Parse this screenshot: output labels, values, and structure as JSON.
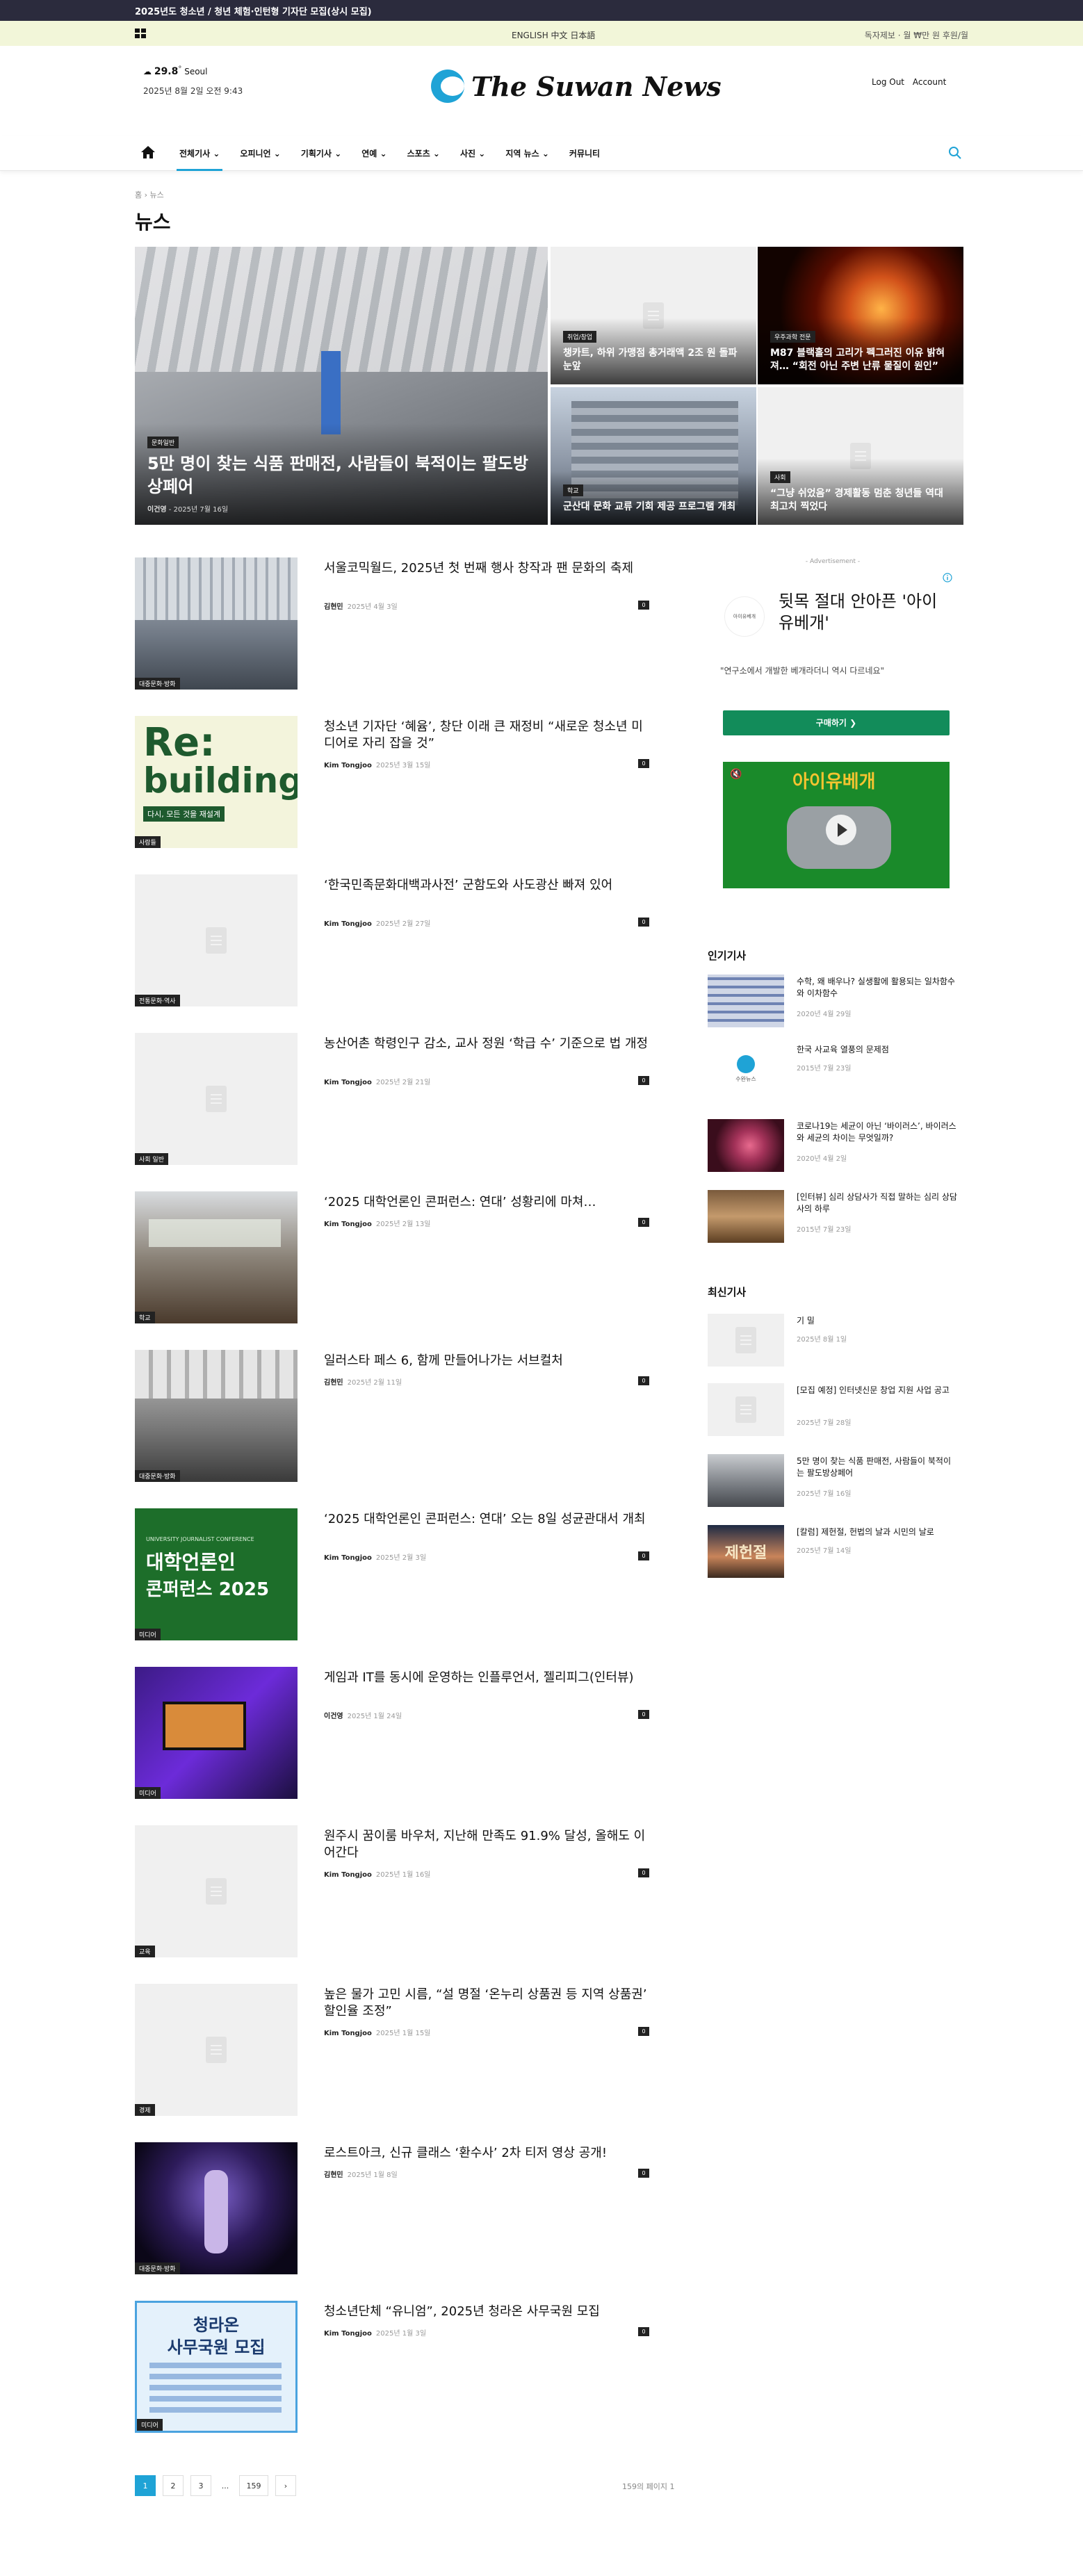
{
  "topbar": {
    "headline": "2025년도 청소년 / 청년 체험·인턴형 기자단 모집(상시 모집)"
  },
  "subbar": {
    "languages": "ENGLISH  中文  日本語",
    "right": "독자제보 · 월 ₩만 원 후원/월"
  },
  "header": {
    "weather_temp": "29.8",
    "weather_unit": "°",
    "weather_city": "Seoul",
    "datetime": "2025년 8월 2일 오전 9:43",
    "logo_text": "The Suwan News",
    "logout": "Log Out",
    "account": "Account"
  },
  "nav": {
    "items": [
      "전체기사",
      "오피니언",
      "기획기사",
      "연예",
      "스포츠",
      "사진",
      "지역 뉴스",
      "커뮤니티"
    ],
    "dropdown_marker": "⌄"
  },
  "breadcrumb": "홈 › 뉴스",
  "page_title": "뉴스",
  "hero": [
    {
      "badge": "문화일반",
      "title": "5만 명이 찾는 식품 판매전, 사람들이 북적이는 팔도방상페어",
      "author": "이건영",
      "date": "2025년 7월 16일"
    },
    {
      "badge": "취업/창업",
      "title": "챙카트, 하위 가맹점 총거래액 2조 원 돌파 눈앞"
    },
    {
      "badge": "우주과학 전문",
      "title": "M87 블랙홀의 고리가 펙그러진 이유 밝혀져… “회전 아닌 주변 난류 물질이 원인”"
    },
    {
      "badge": "학교",
      "title": "군산대 문화 교류 기회 제공 프로그램 개최"
    },
    {
      "badge": "사회",
      "title": "“그냥 쉬었음” 경제활동 멈춘 청년들 역대 최고치 찍었다"
    }
  ],
  "articles": [
    {
      "category": "대중문화·방화",
      "title": "서울코믹월드, 2025년 첫 번째 행사 창작과 팬 문화의 축제",
      "author": "김현민",
      "date": "2025년 4월 3일",
      "comments": "0"
    },
    {
      "category": "사람들",
      "title": "청소년 기자단 ‘혜윰’, 창단 이래 큰 재정비 “새로운 청소년 미디어로 자리 잡을 것”",
      "author": "Kim Tongjoo",
      "date": "2025년 3월 15일",
      "comments": "0"
    },
    {
      "category": "전통문화·역사",
      "title": "‘한국민족문화대백과사전’ 군함도와 사도광산 빠져 있어",
      "author": "Kim Tongjoo",
      "date": "2025년 2월 27일",
      "comments": "0"
    },
    {
      "category": "사회 일반",
      "title": "농산어촌 학령인구 감소, 교사 정원 ‘학급 수’ 기준으로 법 개정",
      "author": "Kim Tongjoo",
      "date": "2025년 2월 21일",
      "comments": "0"
    },
    {
      "category": "학교",
      "title": "‘2025 대학언론인 콘퍼런스: 연대’ 성황리에 마쳐…",
      "author": "Kim Tongjoo",
      "date": "2025년 2월 13일",
      "comments": "0"
    },
    {
      "category": "대중문화·방화",
      "title": "일러스타 페스 6, 함께 만들어나가는 서브컬처",
      "author": "김현민",
      "date": "2025년 2월 11일",
      "comments": "0"
    },
    {
      "category": "미디어",
      "title": "‘2025 대학언론인 콘퍼런스: 연대’ 오는 8일 성균관대서 개최",
      "author": "Kim Tongjoo",
      "date": "2025년 2월 3일",
      "comments": "0"
    },
    {
      "category": "미디어",
      "title": "게임과 IT를 동시에 운영하는 인플루언서, 젤리피그(인터뷰)",
      "author": "이건영",
      "date": "2025년 1월 24일",
      "comments": "0"
    },
    {
      "category": "교육",
      "title": "원주시 꿈이룸 바우처, 지난해 만족도 91.9% 달성, 올해도 이어간다",
      "author": "Kim Tongjoo",
      "date": "2025년 1월 16일",
      "comments": "0"
    },
    {
      "category": "경제",
      "title": "높은 물가 고민 시름, “설 명절 ‘온누리 상품권 등 지역 상품권’ 할인율 조정”",
      "author": "Kim Tongjoo",
      "date": "2025년 1월 15일",
      "comments": "0"
    },
    {
      "category": "대중문화·방화",
      "title": "로스트아크, 신규 클래스 ‘환수사’ 2차 티저 영상 공개!",
      "author": "김현민",
      "date": "2025년 1월 8일",
      "comments": "0"
    },
    {
      "category": "미디어",
      "title": "청소년단체 “유니엄”, 2025년 청라온 사무국원 모집",
      "author": "Kim Tongjoo",
      "date": "2025년 1월 3일",
      "comments": "0"
    }
  ],
  "thumb_texts": {
    "rebuilding_top": "Re:",
    "rebuilding_bottom": "building",
    "rebuilding_sub": "다시, 모든 것을 재설계",
    "conference_line1": "대학언론인",
    "conference_line2": "콘퍼런스 2025",
    "conference_en": "UNIVERSITY JOURNALIST CONFERENCE",
    "recruit_line1": "청라온",
    "recruit_line2": "사무국원 모집"
  },
  "ad": {
    "label": "- Advertisement -",
    "logo": "아이유베개",
    "title": "뒷목 절대 안아픈 '아이유베개'",
    "desc": "\"연구소에서 개발한 베개라더니 역시 다르네요\"",
    "button": "구매하기 ❯",
    "video_title": "아이유베개",
    "mute_icon": "🔇"
  },
  "popular": {
    "title": "인기기사",
    "items": [
      {
        "title": "수학, 왜 배우나? 실생활에 활용되는 일차함수와 이차함수",
        "date": "2020년 4월 29일"
      },
      {
        "title": "한국 사교육 열풍의 문제점",
        "date": "2015년 7월 23일",
        "logo": "수완뉴스"
      },
      {
        "title": "코로나19는 세균이 아닌 ‘바이러스’, 바이러스와 세균의 차이는 무엇일까?",
        "date": "2020년 4월 2일"
      },
      {
        "title": "[인터뷰] 심리 상담사가 직접 말하는 심리 상담사의 하루",
        "date": "2015년 7월 23일"
      }
    ]
  },
  "latest": {
    "title": "최신기사",
    "items": [
      {
        "title": "기 밀",
        "date": "2025년 8월 1일"
      },
      {
        "title": "[모집 예정] 인터넷신문 창업 지원 사업 공고",
        "date": "2025년 7월 28일"
      },
      {
        "title": "5만 명이 찾는 식품 판매전, 사람들이 북적이는 팔도방상페어",
        "date": "2025년 7월 16일"
      },
      {
        "title": "[칼럼] 제헌절, 헌법의 날과 시민의 날로",
        "date": "2025년 7월 14일"
      }
    ],
    "column_thumb": "제헌절"
  },
  "pagination": {
    "pages": [
      "1",
      "2",
      "3",
      "...",
      "159",
      "›"
    ],
    "count": "159의 페이지 1"
  }
}
